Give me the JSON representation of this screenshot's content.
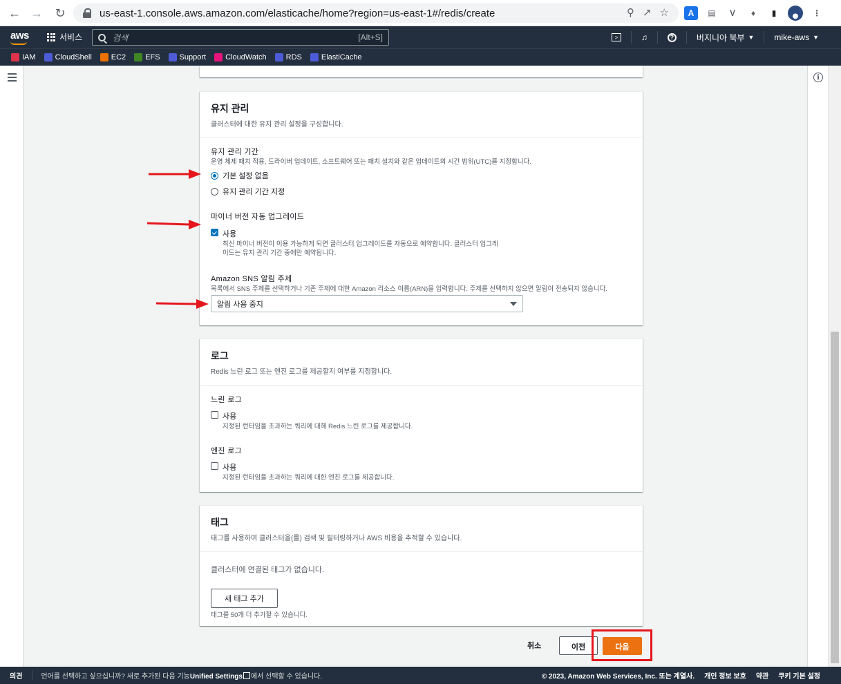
{
  "browser": {
    "url": "us-east-1.console.aws.amazon.com/elasticache/home?region=us-east-1#/redis/create"
  },
  "aws_nav": {
    "logo": "aws",
    "services_label": "서비스",
    "search_placeholder": "검색",
    "search_shortcut": "[Alt+S]",
    "region": "버지니아 북부",
    "account": "mike-aws"
  },
  "bookmarks": [
    {
      "label": "IAM",
      "color": "#dd344c"
    },
    {
      "label": "CloudShell",
      "color": "#4d5cd6"
    },
    {
      "label": "EC2",
      "color": "#ed7100"
    },
    {
      "label": "EFS",
      "color": "#3f8624"
    },
    {
      "label": "Support",
      "color": "#4d5cd6"
    },
    {
      "label": "CloudWatch",
      "color": "#e7157b"
    },
    {
      "label": "RDS",
      "color": "#4d5cd6"
    },
    {
      "label": "ElastiCache",
      "color": "#4d5cd6"
    }
  ],
  "maintenance": {
    "title": "유지 관리",
    "description": "클러스터에 대한 유지 관리 설정을 구성합니다.",
    "window_label": "유지 관리 기간",
    "window_desc": "운영 체제 패치 적용, 드라이버 업데이트, 소프트웨어 또는 패치 설치와 같은 업데이트의 시간 범위(UTC)를 지정합니다.",
    "option_no_pref": "기본 설정 없음",
    "option_specify": "유지 관리 기간 지정",
    "auto_upgrade_label": "마이너 버전 자동 업그레이드",
    "auto_upgrade_check": "사용",
    "auto_upgrade_desc_1": "최신 마이너 버전이 이용 가능하게 되면 클러스터 업그레이드를 자동으로 예약합니다. 클러스터 업그레",
    "auto_upgrade_desc_2": "이드는 유지 관리 기간 중에만 예약됩니다.",
    "sns_label": "Amazon SNS 알림 주제",
    "sns_desc": "목록에서 SNS 주제를 선택하거나 기존 주제에 대한 Amazon 리소스 이름(ARN)을 입력합니다. 주제를 선택하지 않으면 알림이 전송되지 않습니다.",
    "sns_value": "알림 사용 중지"
  },
  "logs": {
    "title": "로그",
    "description": "Redis 느린 로그 또는 엔진 로그를 제공할지 여부를 지정합니다.",
    "slow_label": "느린 로그",
    "slow_check": "사용",
    "slow_desc": "지정된 런타임을 초과하는 쿼리에 대해 Redis 느린 로그를 제공합니다.",
    "engine_label": "엔진 로그",
    "engine_check": "사용",
    "engine_desc": "지정된 런타임을 초과하는 쿼리에 대한 엔진 로그를 제공합니다."
  },
  "tags": {
    "title": "태그",
    "description": "태그를 사용하여 클러스터을(를) 검색 및 필터링하거나 AWS 비용을 추적할 수 있습니다.",
    "empty": "클러스터에 연결된 태그가 없습니다.",
    "add_button": "새 태그 추가",
    "limit": "태그를 50개 더 추가할 수 있습니다."
  },
  "actions": {
    "cancel": "취소",
    "previous": "이전",
    "next": "다음"
  },
  "footer": {
    "feedback": "의견",
    "lang_prefix": "언어를 선택하고 싶으십니까? 새로 추가된 다음 기능",
    "lang_link": "Unified Settings",
    "lang_suffix": "에서 선택할 수 있습니다.",
    "copyright": "© 2023, Amazon Web Services, Inc. 또는 계열사.",
    "privacy": "개인 정보 보호",
    "terms": "약관",
    "cookies": "쿠키 기본 설정"
  },
  "colors": {
    "primary_button": "#ec7211",
    "highlight_box": "#e5161b",
    "annotation_arrow": "#e5161b",
    "selected": "#0073bb"
  }
}
